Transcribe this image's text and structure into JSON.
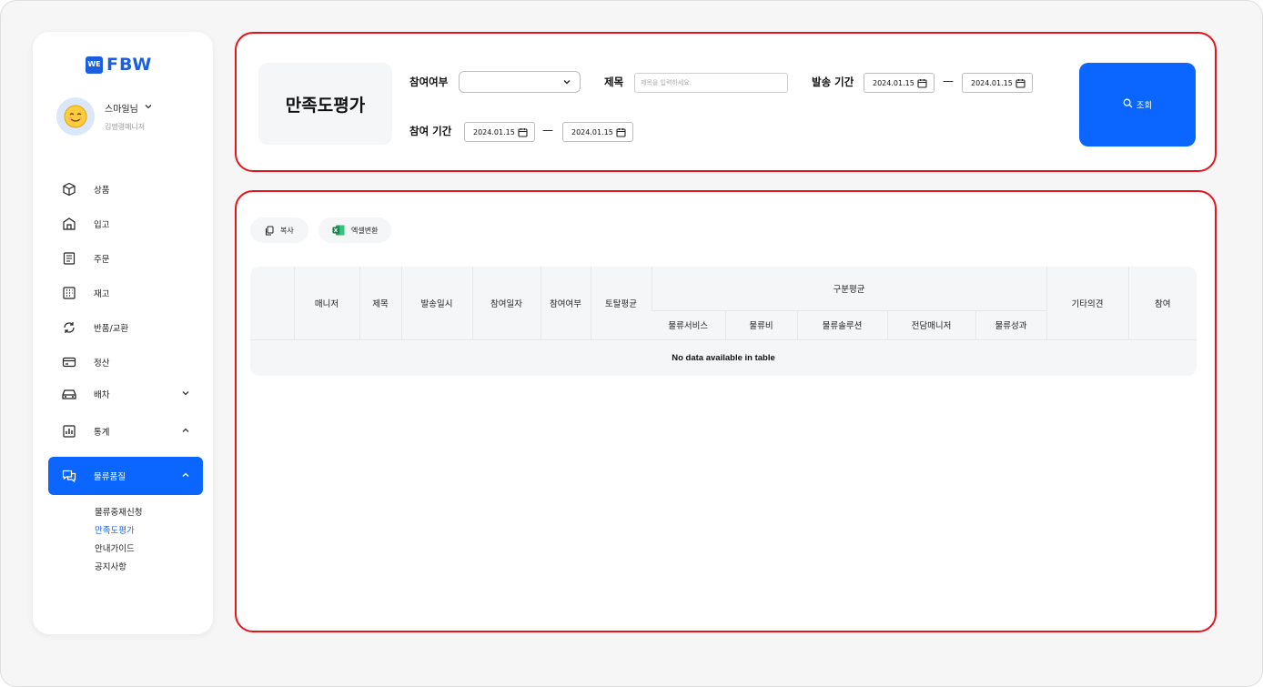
{
  "brand": {
    "mark": "WE",
    "name": "FBW"
  },
  "profile": {
    "name": "스마일님",
    "role": "김명령매니저"
  },
  "nav": [
    {
      "label": "상품",
      "icon": "box-icon"
    },
    {
      "label": "입고",
      "icon": "warehouse-icon"
    },
    {
      "label": "주문",
      "icon": "receipt-icon"
    },
    {
      "label": "재고",
      "icon": "grid-icon"
    },
    {
      "label": "반품/교환",
      "icon": "refresh-icon"
    },
    {
      "label": "정산",
      "icon": "card-icon"
    },
    {
      "label": "배차",
      "icon": "car-icon"
    },
    {
      "label": "통계",
      "icon": "chart-icon"
    },
    {
      "label": "물류품질",
      "icon": "chat-icon"
    }
  ],
  "subnav": [
    "물류중재신청",
    "만족도평가",
    "안내가이드",
    "공지사항"
  ],
  "page_title": "만족도평가",
  "filters": {
    "participation_label": "참여여부",
    "subject_label": "제목",
    "subject_placeholder": "제목을 입력하세요.",
    "send_period_label": "발송 기간",
    "participation_period_label": "참여 기간",
    "send_start": "2024.01.15",
    "send_end": "2024.01.15",
    "part_start": "2024.01.15",
    "part_end": "2024.01.15",
    "dash": "—",
    "search_label": "조회"
  },
  "actions": {
    "copy_label": "복사",
    "excel_label": "엑셀변환"
  },
  "table": {
    "headers": [
      "",
      "매니저",
      "제목",
      "발송일시",
      "참여일자",
      "참여여부",
      "토탈평균",
      "구분평균",
      "기타의견",
      "참여"
    ],
    "sub_headers": [
      "물류서비스",
      "물류비",
      "물류솔루션",
      "전담매니저",
      "물류성과"
    ],
    "empty_message": "No data available in table"
  },
  "colors": {
    "accent": "#0a66ff",
    "highlight_border": "#e5141b",
    "brand": "#1b5fe0"
  }
}
